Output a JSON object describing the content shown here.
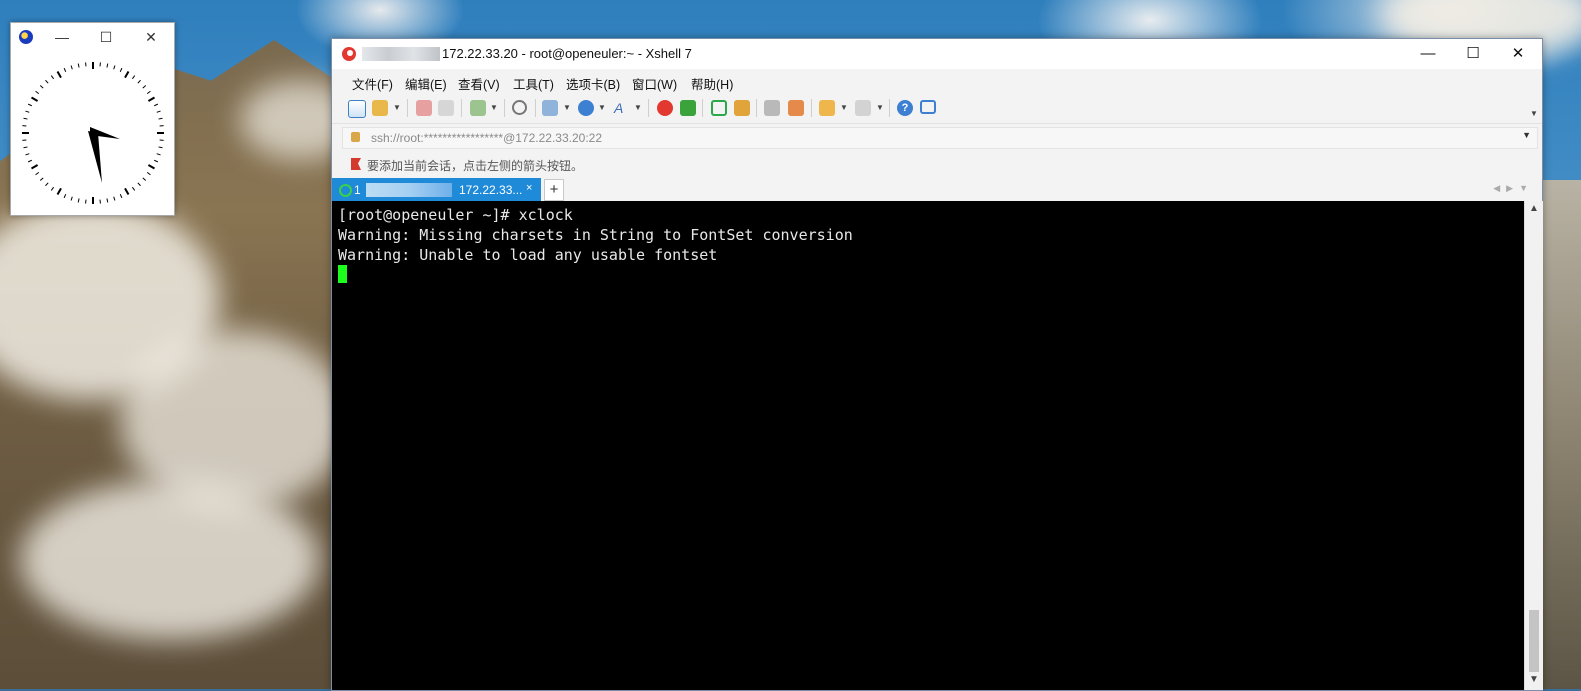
{
  "xclock": {
    "title_icon": "xclock-app-icon",
    "buttons": {
      "minimize": "—",
      "maximize": "☐",
      "close": "✕"
    }
  },
  "xshell": {
    "title": "172.22.33.20 - root@openeuler:~ - Xshell 7",
    "window_buttons": {
      "minimize": "—",
      "maximize": "☐",
      "close": "✕"
    },
    "menu": [
      "文件(F)",
      "编辑(E)",
      "查看(V)",
      "工具(T)",
      "选项卡(B)",
      "窗口(W)",
      "帮助(H)"
    ],
    "address": "ssh://root:*****************@172.22.33.20:22",
    "hint": "要添加当前会话，点击左侧的箭头按钮。",
    "tab": {
      "number": "1",
      "label": "172.22.33...",
      "close": "×",
      "add": "+"
    },
    "terminal_lines": [
      "[root@openeuler ~]# xclock",
      "Warning: Missing charsets in String to FontSet conversion",
      "Warning: Unable to load any usable fontset"
    ],
    "colors": {
      "accent": "#1f8ad8",
      "cursor": "#1cff1c",
      "terminal_bg": "#000000",
      "terminal_fg": "#e8e8e8"
    }
  }
}
